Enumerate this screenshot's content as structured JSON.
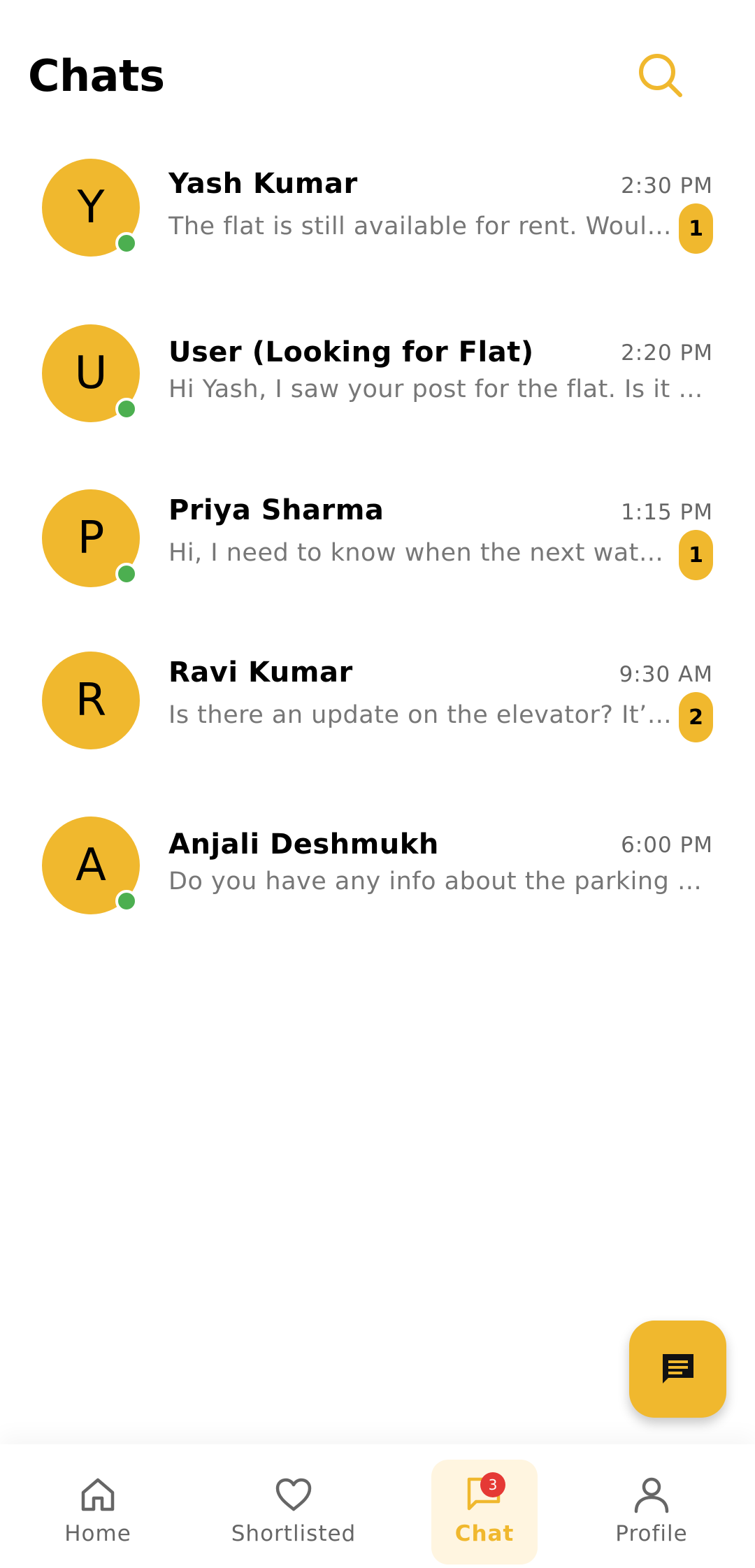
{
  "header": {
    "title": "Chats"
  },
  "chats": [
    {
      "initial": "Y",
      "name": "Yash Kumar",
      "time": "2:30 PM",
      "preview": "The flat is still available for rent. Would you like to schedule a visit?",
      "unread": "1",
      "online": true
    },
    {
      "initial": "U",
      "name": "User (Looking for Flat)",
      "time": "2:20 PM",
      "preview": "Hi Yash, I saw your post for the flat. Is it still available?",
      "unread": "",
      "online": true
    },
    {
      "initial": "P",
      "name": "Priya Sharma",
      "time": "1:15 PM",
      "preview": "Hi, I need to know when the next water supply schedule is.",
      "unread": "1",
      "online": true
    },
    {
      "initial": "R",
      "name": "Ravi Kumar",
      "time": "9:30 AM",
      "preview": "Is there an update on the elevator? It’s been down for days.",
      "unread": "2",
      "online": false
    },
    {
      "initial": "A",
      "name": "Anjali Deshmukh",
      "time": "6:00 PM",
      "preview": "Do you have any info about the parking situation near the building?",
      "unread": "",
      "online": true
    }
  ],
  "bottom_nav": {
    "items": [
      {
        "label": "Home",
        "icon": "home-icon"
      },
      {
        "label": "Shortlisted",
        "icon": "heart-icon"
      },
      {
        "label": "Chat",
        "icon": "chat-icon",
        "badge": "3",
        "active": true
      },
      {
        "label": "Profile",
        "icon": "person-icon"
      }
    ]
  },
  "colors": {
    "accent": "#F0B82E",
    "online": "#4CAF50",
    "badge_red": "#E53935"
  }
}
